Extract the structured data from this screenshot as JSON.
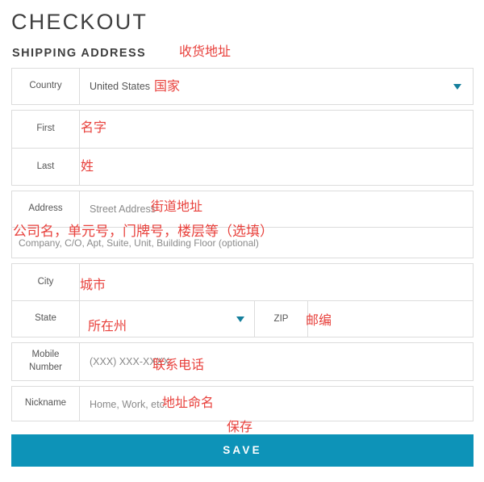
{
  "header": {
    "page_title": "CHECKOUT",
    "section_title": "SHIPPING ADDRESS",
    "section_annotation": "收货地址"
  },
  "colors": {
    "accent_teal": "#0d93b8",
    "caret_teal": "#157f9c",
    "annotation_red": "#e8413c",
    "border_gray": "#dcdcdc",
    "label_gray": "#555555",
    "placeholder_gray": "#8a8a8a",
    "heading_gray": "#3f3f3f"
  },
  "form": {
    "country": {
      "label": "Country",
      "value": "United States",
      "annotation": "国家",
      "caret_icon": "chevron-down-icon"
    },
    "first": {
      "label": "First",
      "value": "",
      "placeholder": "",
      "annotation": "名字"
    },
    "last": {
      "label": "Last",
      "value": "",
      "placeholder": "",
      "annotation": "姓"
    },
    "address": {
      "label": "Address",
      "placeholder": "Street Address",
      "annotation": "街道地址",
      "line2_placeholder": "Company, C/O, Apt, Suite, Unit, Building Floor (optional)",
      "line2_annotation": "公司名，单元号，门牌号，楼层等（选填）"
    },
    "city": {
      "label": "City",
      "value": "",
      "placeholder": "",
      "annotation": "城市"
    },
    "state": {
      "label": "State",
      "value": "",
      "placeholder": "",
      "annotation": "所在州",
      "caret_icon": "chevron-down-icon"
    },
    "zip": {
      "label": "ZIP",
      "value": "",
      "placeholder": "",
      "annotation": "邮编"
    },
    "mobile": {
      "label": "Mobile Number",
      "placeholder": "(XXX) XXX-XXXX",
      "annotation": "联系电话"
    },
    "nickname": {
      "label": "Nickname",
      "placeholder": "Home, Work, etc.",
      "annotation": "地址命名"
    }
  },
  "actions": {
    "save_label": "SAVE",
    "save_annotation": "保存"
  }
}
